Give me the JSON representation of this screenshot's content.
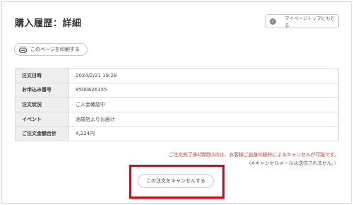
{
  "header": {
    "title": "購入履歴：詳細",
    "back_button_label": "マイページトップにもどる",
    "back_icon": "chevron-left-icon"
  },
  "actions": {
    "print_label": "このページを印刷する",
    "print_icon": "printer-icon",
    "cancel_label": "この注文をキャンセルする"
  },
  "order": {
    "rows": [
      {
        "label": "注文日時",
        "value": "2024/2/21 19:28"
      },
      {
        "label": "お申込み番号",
        "value": "9500626155"
      },
      {
        "label": "注文状況",
        "value": "ご入金確認中"
      },
      {
        "label": "イベント",
        "value": "池袋店よりお届け"
      },
      {
        "label": "ご注文金額合計",
        "value": "4,224円"
      }
    ]
  },
  "notices": {
    "cancel_window": "ご注文完了後1時間以内は、お客様ご自身の操作によるキャンセルが可能です。",
    "no_email": "（※キャンセルメールは送信されません。）"
  },
  "colors": {
    "accent_red": "#e60012",
    "notice_red": "#d9332b"
  }
}
